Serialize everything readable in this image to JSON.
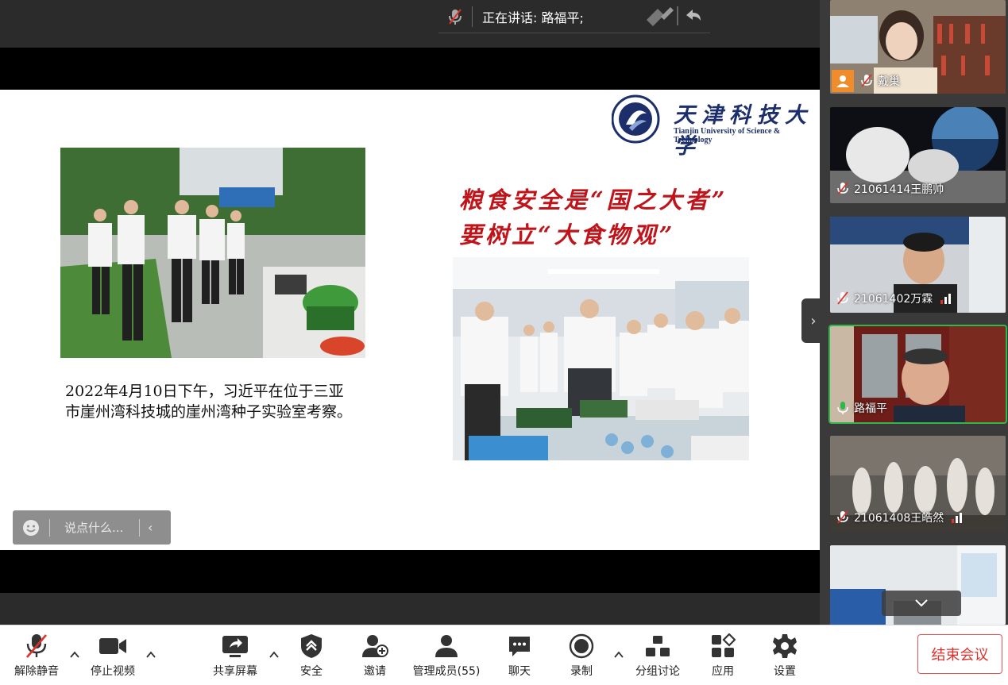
{
  "top_bar": {
    "speaking_label": "正在讲话: 路福平;"
  },
  "slide": {
    "logo_cn": "天津科技大学",
    "logo_en": "Tianjin University of Science & Technology",
    "headline_line1": "粮食安全是“国之大者”",
    "headline_line2": "要树立“大食物观”",
    "caption_line1": "2022年4月10日下午，习近平在位于三亚",
    "caption_line2": "市崖州湾科技城的崖州湾种子实验室考察。"
  },
  "chat": {
    "placeholder": "说点什么..."
  },
  "participants": [
    {
      "name": "戴巢",
      "muted": true,
      "signal": false
    },
    {
      "name": "21061414王鹏帅",
      "muted": true,
      "signal": false
    },
    {
      "name": "21061402万霖",
      "muted": true,
      "signal": true
    },
    {
      "name": "路福平",
      "muted": false,
      "signal": false,
      "active": true
    },
    {
      "name": "21061408王皓然",
      "muted": true,
      "signal": true
    },
    {
      "name": "",
      "muted": true,
      "signal": false
    }
  ],
  "toolbar": {
    "unmute": "解除静音",
    "stop_video": "停止视频",
    "share_screen": "共享屏幕",
    "security": "安全",
    "invite": "邀请",
    "manage_members": "管理成员(55)",
    "chat": "聊天",
    "record": "录制",
    "breakout": "分组讨论",
    "apps": "应用",
    "settings": "设置",
    "end_meeting": "结束会议"
  },
  "colors": {
    "accent_red": "#e0312b",
    "active_green": "#2fb84a",
    "headline_red": "#c0141b",
    "university_blue": "#1d2f6a"
  }
}
